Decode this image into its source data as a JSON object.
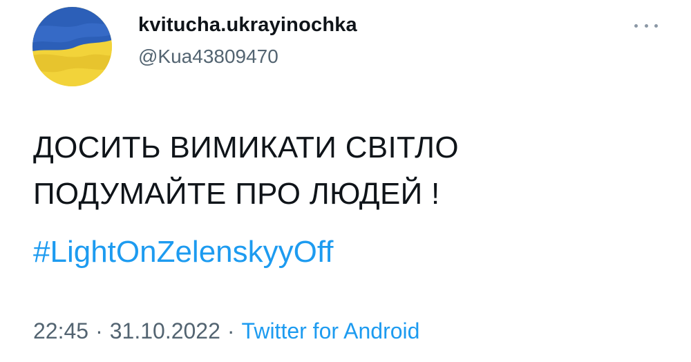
{
  "author": {
    "display_name": "kvitucha.ukrayinochka",
    "handle": "@Kua43809470",
    "avatar_icon": "ukrainian-flag-avatar",
    "avatar_colors": {
      "blue": "#2c5fb8",
      "yellow": "#f2d33a"
    }
  },
  "header": {
    "more_icon": "more-horizontal-icon"
  },
  "tweet": {
    "lines": [
      "ДОСИТЬ ВИМИКАТИ СВІТЛО",
      "ПОДУМАЙТЕ ПРО ЛЮДЕЙ !"
    ],
    "hashtag": "#LightOnZelenskyyOff"
  },
  "meta": {
    "time": "22:45",
    "date": "31.10.2022",
    "separator": "·",
    "source": "Twitter for Android"
  },
  "colors": {
    "link": "#1d9bf0",
    "text": "#0f1419",
    "secondary": "#536471"
  }
}
